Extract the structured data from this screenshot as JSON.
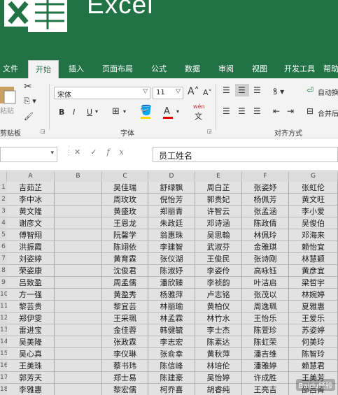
{
  "app": {
    "title": "Excel",
    "accent": "#217346"
  },
  "tabs": [
    "文件",
    "开始",
    "插入",
    "页面布局",
    "公式",
    "数据",
    "审阅",
    "视图",
    "开发工具",
    "帮助"
  ],
  "active_tab": "开始",
  "ribbon": {
    "clipboard": {
      "paste": "粘贴",
      "group": "剪贴板"
    },
    "font": {
      "name": "宋体",
      "size": "11",
      "bold": "B",
      "italic": "I",
      "underline": "U",
      "phonetic": "wén",
      "group": "字体"
    },
    "alignment": {
      "wrap": "自动换",
      "merge": "合并后",
      "group": "对齐方式"
    }
  },
  "formula_bar": {
    "name_box": "",
    "content": "员工姓名",
    "fx": "fx"
  },
  "columns": [
    "A",
    "B",
    "C",
    "D",
    "E",
    "F",
    "G"
  ],
  "rows": [
    {
      "num": "1",
      "a": "吉茹芷",
      "c": "吴佳瑞",
      "d": "舒绿飘",
      "e": "周白芷",
      "f": "张姿妤",
      "g": "张虹伦"
    },
    {
      "num": "2",
      "a": "李中冰",
      "c": "周玫玫",
      "d": "倪怡芳",
      "e": "郭贵妃",
      "f": "杨佩芳",
      "g": "黄文旺"
    },
    {
      "num": "3",
      "a": "黄文隆",
      "c": "黄盛玫",
      "d": "郑丽青",
      "e": "许智云",
      "f": "张孟涵",
      "g": "李小爱"
    },
    {
      "num": "4",
      "a": "谢彦文",
      "c": "王恩龙",
      "d": "朱政廷",
      "e": "邓诗涵",
      "f": "陈政倩",
      "g": "吴俊伯"
    },
    {
      "num": "5",
      "a": "傅智翔",
      "c": "阮馨学",
      "d": "翁惠珠",
      "e": "吴思翰",
      "f": "林佩玲",
      "g": "邓海来"
    },
    {
      "num": "6",
      "a": "洪振霞",
      "c": "陈翊依",
      "d": "李建智",
      "e": "武淑芬",
      "f": "金雅琪",
      "g": "赖怡宜"
    },
    {
      "num": "7",
      "a": "刘姿婷",
      "c": "黄育霖",
      "d": "张仪湖",
      "e": "王俊民",
      "f": "张诗刚",
      "g": "林慧颖"
    },
    {
      "num": "8",
      "a": "荣姿康",
      "c": "沈俊君",
      "d": "陈淑妤",
      "e": "李姿伶",
      "f": "高咏钰",
      "g": "黄彦宜"
    },
    {
      "num": "9",
      "a": "吕致盈",
      "c": "周孟儒",
      "d": "潘欣臻",
      "e": "李祯韵",
      "f": "叶洁启",
      "g": "梁哲宇"
    },
    {
      "num": "10",
      "a": "方一强",
      "c": "黄盈秀",
      "d": "杨雅萍",
      "e": "卢志铭",
      "f": "张茂以",
      "g": "林婉婷"
    },
    {
      "num": "11",
      "a": "黎芸贵",
      "c": "黎宜芸",
      "d": "林丽瑜",
      "e": "黄柏仪",
      "f": "周逸珮",
      "g": "夏雅惠"
    },
    {
      "num": "12",
      "a": "郑伊雯",
      "c": "王采珮",
      "d": "林孟霖",
      "e": "林竹水",
      "f": "王怡乐",
      "g": "王爱乐"
    },
    {
      "num": "13",
      "a": "雷进宝",
      "c": "金佳蓉",
      "d": "韩健毓",
      "e": "李士杰",
      "f": "陈萱珍",
      "g": "苏姿婷"
    },
    {
      "num": "14",
      "a": "吴美隆",
      "c": "张政霖",
      "d": "李志宏",
      "e": "陈素达",
      "f": "陈虹荣",
      "g": "何美玲"
    },
    {
      "num": "15",
      "a": "吴心真",
      "c": "李仪琳",
      "d": "张俞幸",
      "e": "黄秋萍",
      "f": "潘吉维",
      "g": "陈智玲"
    },
    {
      "num": "16",
      "a": "王美珠",
      "c": "蔡书玮",
      "d": "陈信峰",
      "e": "林培伦",
      "f": "潘雅婷",
      "g": "赖慧君"
    },
    {
      "num": "17",
      "a": "郭芳天",
      "c": "郑士易",
      "d": "陈建豪",
      "e": "吴怡婷",
      "f": "许成胜",
      "g": "王美芳"
    },
    {
      "num": "18",
      "a": "李雅惠",
      "c": "黎宏儒",
      "d": "柯乔喜",
      "e": "胡睿纯",
      "f": "王亮吉",
      "g": "邵吕菁"
    }
  ],
  "watermark": "Baidu经验"
}
